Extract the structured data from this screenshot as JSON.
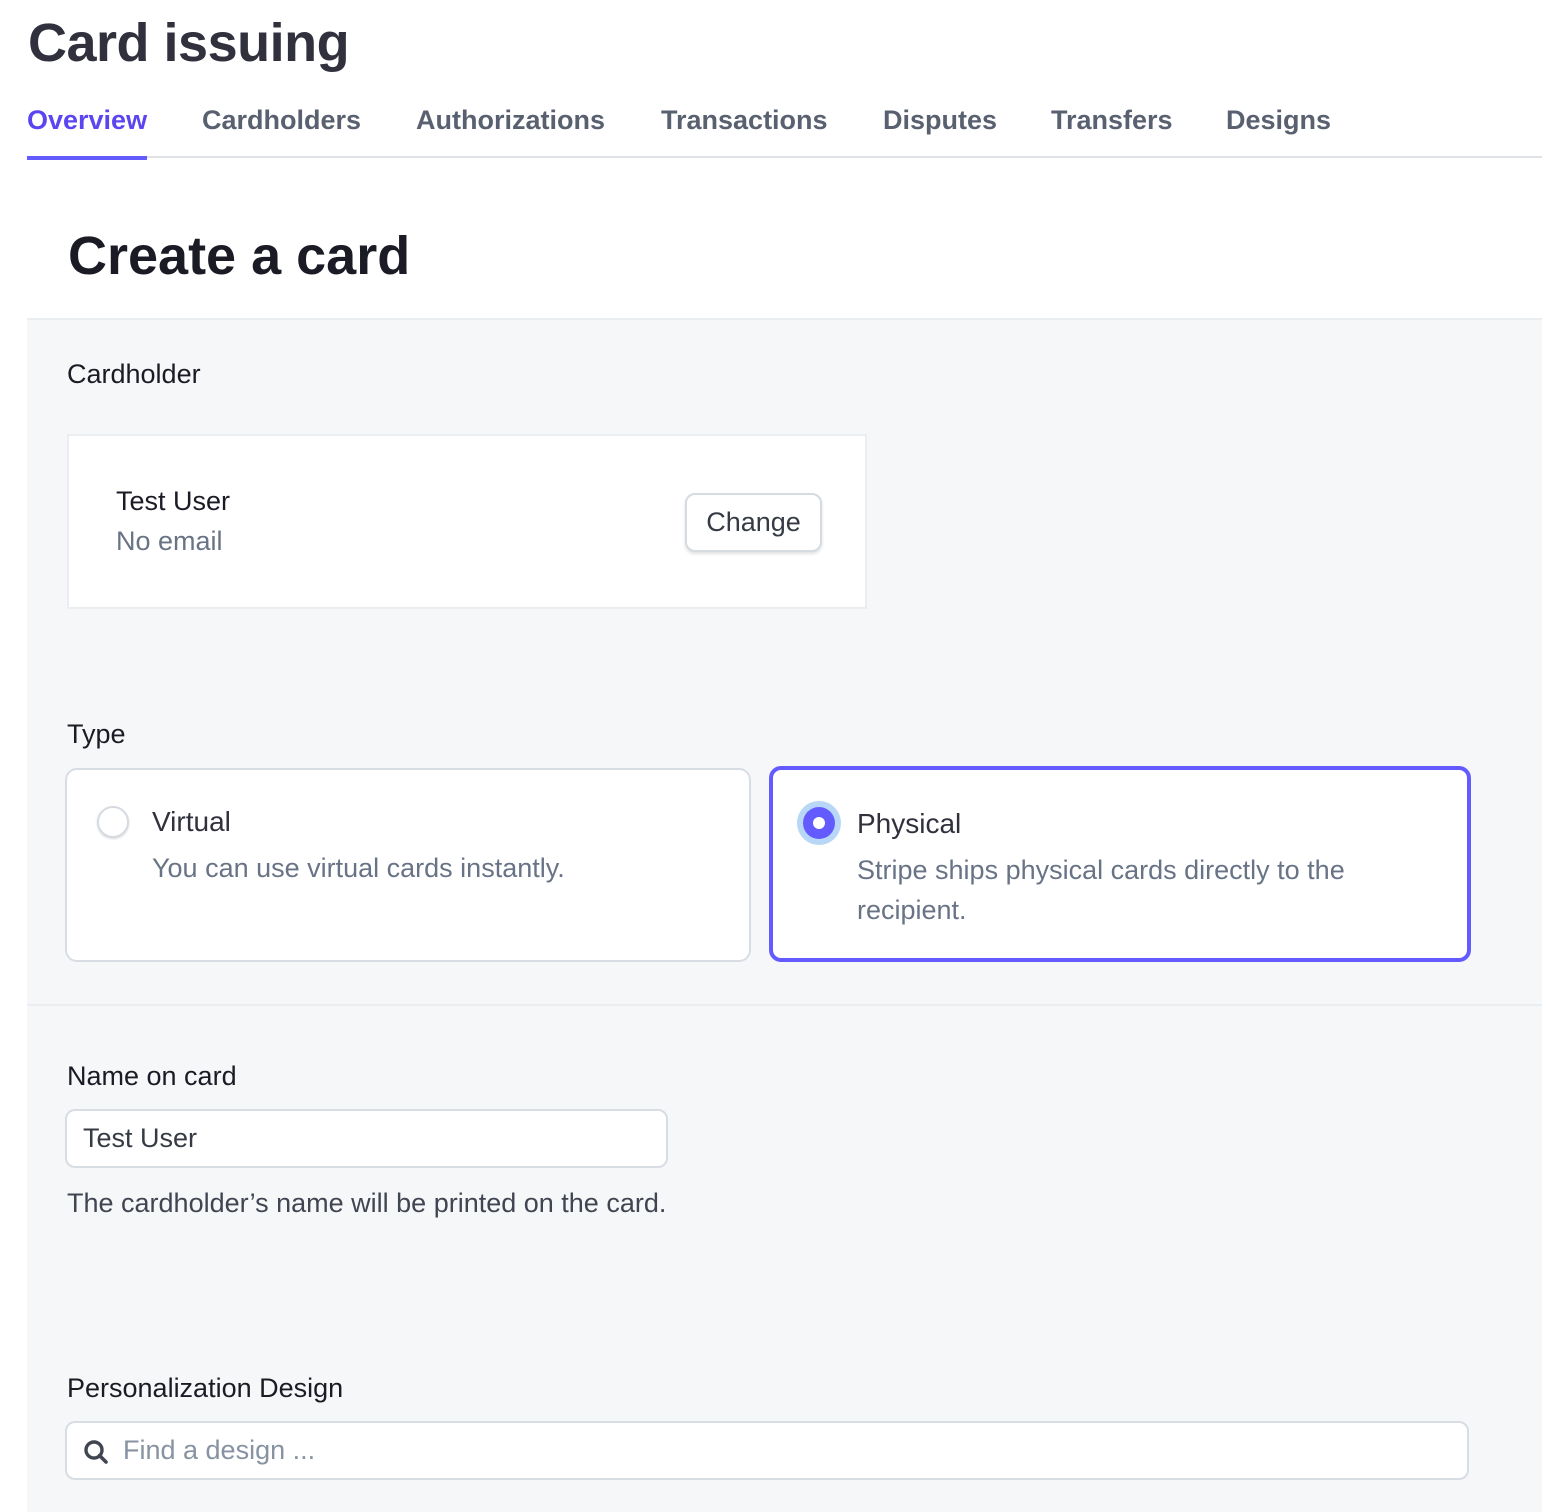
{
  "app": {
    "title": "Card issuing"
  },
  "tabs": [
    {
      "label": "Overview",
      "active": true
    },
    {
      "label": "Cardholders",
      "active": false
    },
    {
      "label": "Authorizations",
      "active": false
    },
    {
      "label": "Transactions",
      "active": false
    },
    {
      "label": "Disputes",
      "active": false
    },
    {
      "label": "Transfers",
      "active": false
    },
    {
      "label": "Designs",
      "active": false
    }
  ],
  "page": {
    "title": "Create a card"
  },
  "cardholder": {
    "label": "Cardholder",
    "name": "Test User",
    "email": "No email",
    "change_label": "Change"
  },
  "type": {
    "label": "Type",
    "selected": "Physical",
    "options": [
      {
        "title": "Virtual",
        "description": "You can use virtual cards instantly.",
        "checked": false
      },
      {
        "title": "Physical",
        "description": "Stripe ships physical cards directly to the recipient.",
        "checked": true
      }
    ]
  },
  "name_on_card": {
    "label": "Name on card",
    "value": "Test User",
    "help": "The cardholder’s name will be printed on the card."
  },
  "personalization": {
    "label": "Personalization Design",
    "placeholder": "Find a design ...",
    "value": "",
    "search_icon": "search-icon"
  },
  "colors": {
    "accent": "#635bff",
    "active_tab_text": "#5b45f0",
    "panel_background": "#f6f7f9",
    "radio_focus_ring": "#b8d7f7"
  }
}
